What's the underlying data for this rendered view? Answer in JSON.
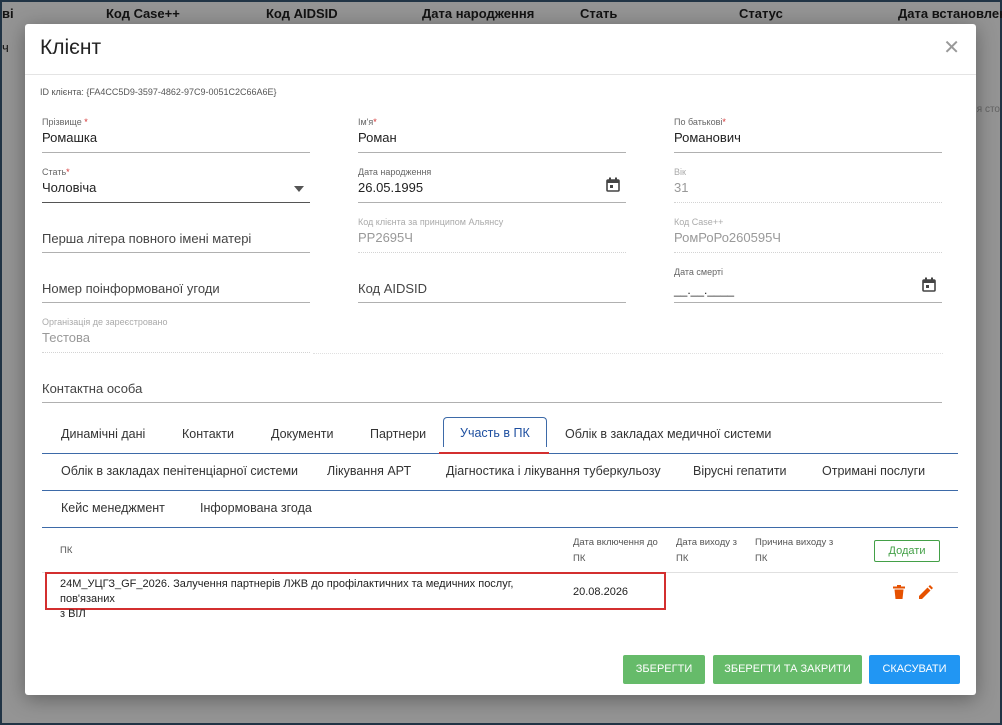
{
  "background": {
    "columns": [
      "ві",
      "Код Case++",
      "Код AIDSID",
      "Дата народження",
      "Стать",
      "Статус",
      "Дата встановлення"
    ],
    "row_text": "ч",
    "side_text": "я сто"
  },
  "modal": {
    "title": "Клієнт",
    "client_id": "ID клієнта: {FA4CC5D9-3597-4862-97C9-0051C2C66A6E}"
  },
  "fields": {
    "surname": {
      "label": "Прізвище",
      "req": "*",
      "value": "Ромашка"
    },
    "name": {
      "label": "Ім'я",
      "req": "*",
      "value": "Роман"
    },
    "patronymic": {
      "label": "По батькові",
      "req": "*",
      "value": "Романович"
    },
    "sex": {
      "label": "Стать",
      "req": "*",
      "value": "Чоловіча"
    },
    "birth_date": {
      "label": "Дата народження",
      "value": "26.05.1995"
    },
    "age": {
      "label": "Вік",
      "value": "31"
    },
    "mother_letter": {
      "placeholder": "Перша літера повного імені матері"
    },
    "alliance_code": {
      "label": "Код клієнта за принципом Альянсу",
      "value": "РР2695Ч"
    },
    "case_code": {
      "label": "Код Case++",
      "value": "РомРоРо260595Ч"
    },
    "agreement_number": {
      "placeholder": "Номер поінформованої угоди"
    },
    "aidsid_code": {
      "placeholder": "Код AIDSID"
    },
    "death_date": {
      "label": "Дата смерті",
      "value": "__.__.____"
    },
    "organization": {
      "label": "Організація де зареєстровано",
      "value": "Тестова"
    },
    "contact_person": {
      "placeholder": "Контактна особа"
    }
  },
  "tabs": {
    "row1": [
      "Динамічні дані",
      "Контакти",
      "Документи",
      "Партнери",
      "Участь в ПК",
      "Облік в закладах медичної системи"
    ],
    "row2": [
      "Облік в закладах пенітенціарної системи",
      "Лікування АРТ",
      "Діагностика і лікування туберкульозу",
      "Вірусні гепатити",
      "Отримані послуги"
    ],
    "row3": [
      "Кейс менеджмент",
      "Інформована згода"
    ],
    "active": "Участь в ПК"
  },
  "table": {
    "headers": {
      "pk": "ПК",
      "date_in_1": "Дата включення до",
      "date_in_2": "ПК",
      "date_out_1": "Дата виходу з",
      "date_out_2": "ПК",
      "reason_1": "Причина виходу з",
      "reason_2": "ПК"
    },
    "add_label": "Додати",
    "rows": [
      {
        "pk_line1": "24М_УЦГЗ_GF_2026. Залучення партнерів ЛЖВ до профілактичних та медичних послуг, пов'язаних",
        "pk_line2": "з ВІЛ",
        "date_in": "20.08.2026",
        "date_out": "",
        "reason": ""
      }
    ]
  },
  "footer": {
    "save": "ЗБЕРЕГТИ",
    "save_close": "ЗБЕРЕГТИ ТА ЗАКРИТИ",
    "cancel": "СКАСУВАТИ"
  },
  "colors": {
    "accent_blue": "#2196f3",
    "save_green": "#66bb6a",
    "danger_red": "#d32f2f",
    "edit_orange": "#e65100"
  }
}
